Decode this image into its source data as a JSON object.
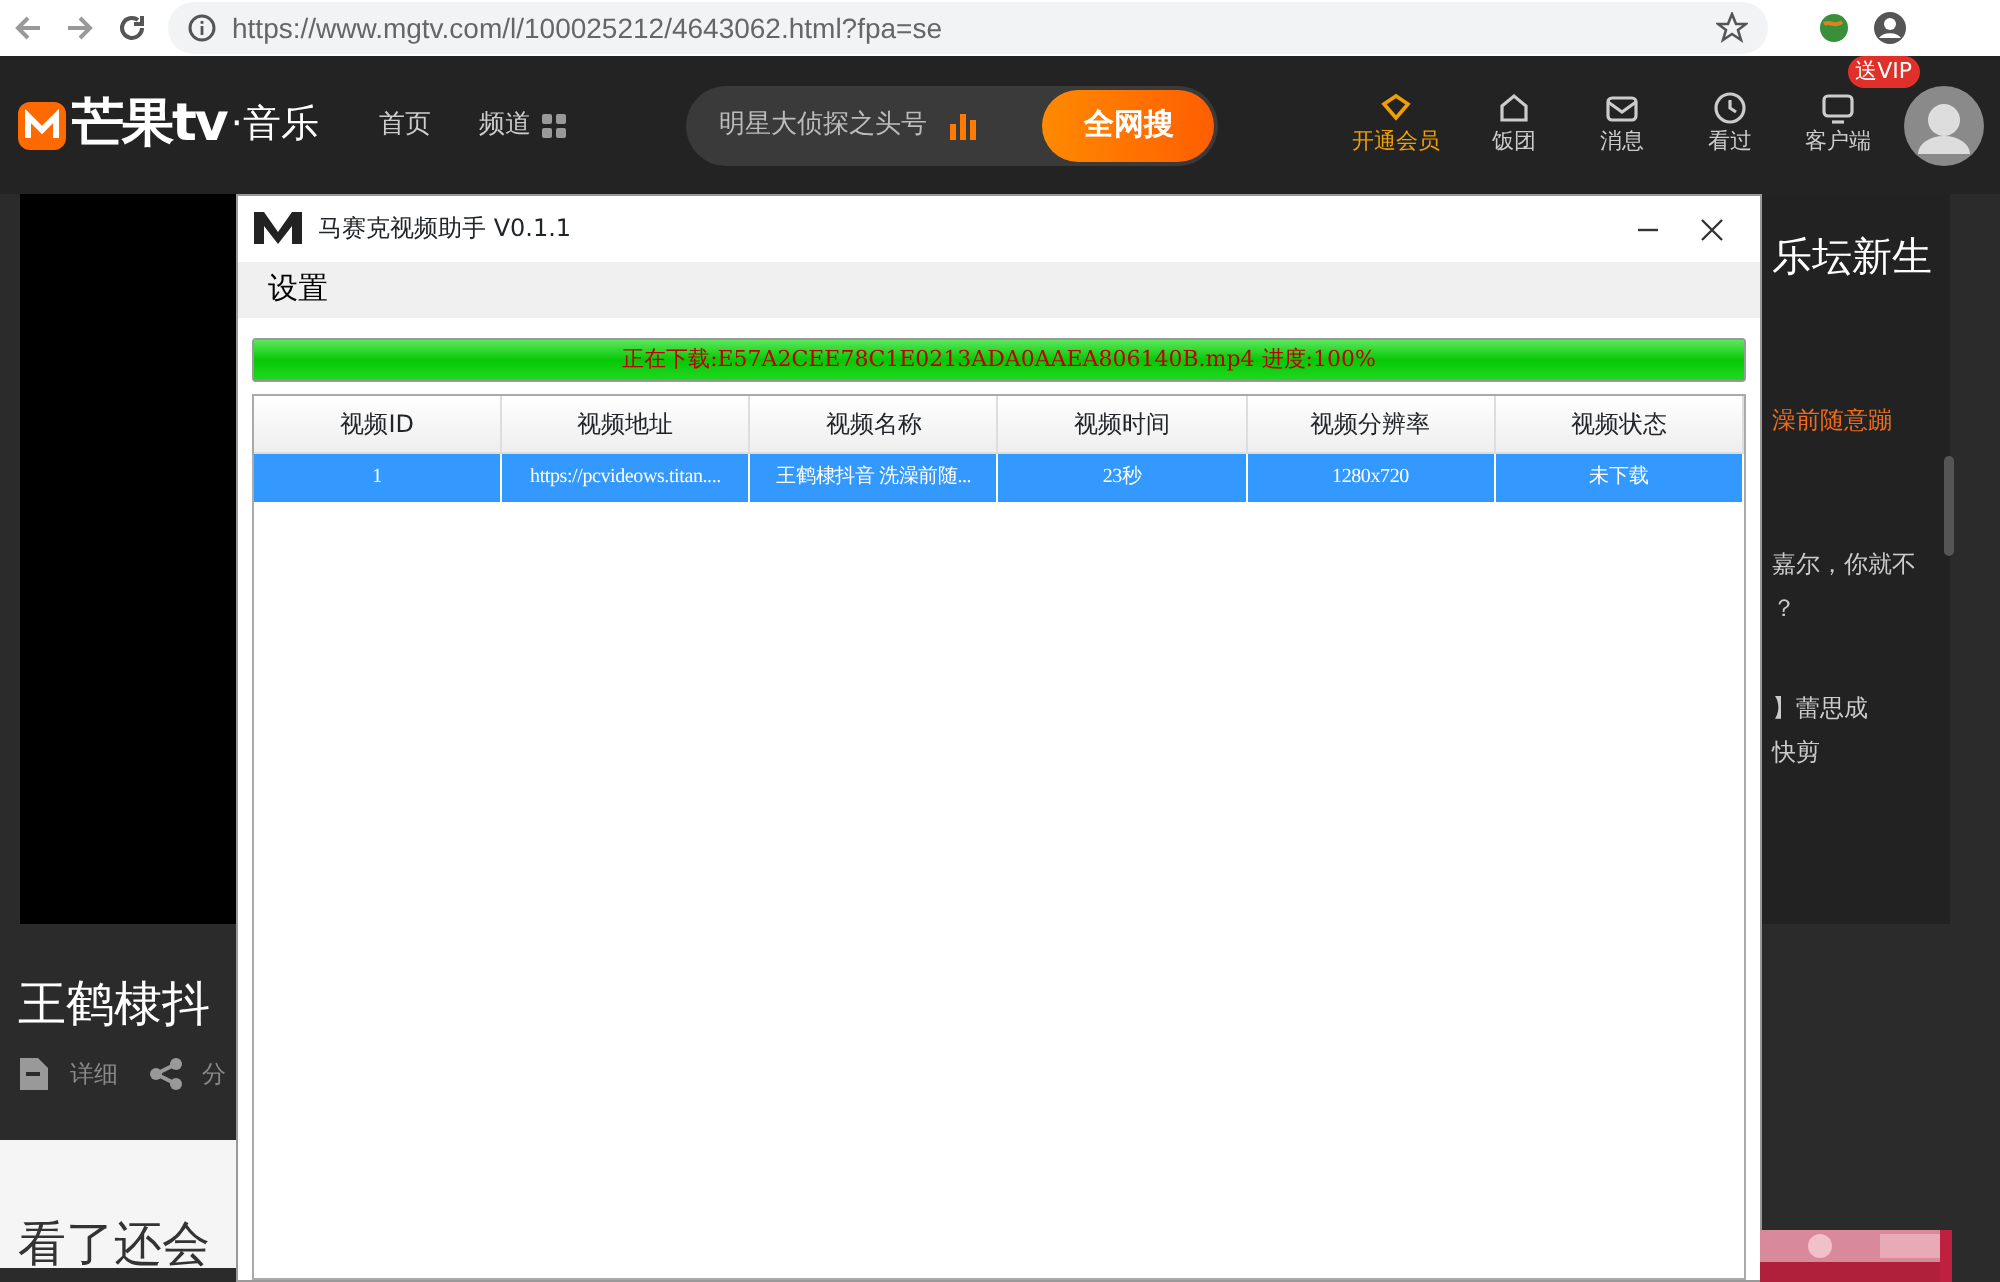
{
  "browser": {
    "url": "https://www.mgtv.com/l/100025212/4643062.html?fpa=se"
  },
  "site_header": {
    "logo": "芒果tv",
    "channel": "·音乐",
    "nav": [
      {
        "label": "首页",
        "kind": "text"
      },
      {
        "label": "频道",
        "kind": "grid"
      }
    ],
    "search": {
      "placeholder": "明星大侦探之头号",
      "button": "全网搜"
    },
    "actions": [
      {
        "label": "开通会员",
        "kind": "vip"
      },
      {
        "label": "饭团",
        "kind": "group"
      },
      {
        "label": "消息",
        "kind": "mail"
      },
      {
        "label": "看过",
        "kind": "clock"
      },
      {
        "label": "客户端",
        "kind": "screen",
        "badge": "送VIP"
      }
    ]
  },
  "video": {
    "title": "王鹤棣抖",
    "actions": [
      {
        "label": "详细",
        "kind": "doc"
      },
      {
        "label": "分",
        "kind": "share"
      }
    ]
  },
  "recommend_heading": "看了还会",
  "side_list": [
    {
      "lines": [
        "乐坛新生"
      ],
      "kind": "heading"
    },
    {
      "lines": [
        "澡前随意蹦"
      ],
      "kind": "current"
    },
    {
      "lines": [
        "嘉尔，你就不",
        "？"
      ],
      "kind": "item"
    },
    {
      "lines": [
        "】蕾思成",
        "快剪"
      ],
      "kind": "item"
    }
  ],
  "dialog": {
    "title": "马赛克视频助手 V0.1.1",
    "menu": [
      "设置"
    ],
    "progress": {
      "level": 1,
      "text": "正在下载:E57A2CEE78C1E0213ADA0AAEA806140B.mp4 进度:100%"
    },
    "table": {
      "columns": [
        "视频ID",
        "视频地址",
        "视频名称",
        "视频时间",
        "视频分辨率",
        "视频状态"
      ],
      "rows": [
        {
          "cells": [
            "1",
            "https://pcvideows.titan....",
            "王鹤棣抖音 洗澡前随...",
            "23秒",
            "1280x720",
            "未下载"
          ],
          "selected": true
        }
      ]
    }
  }
}
